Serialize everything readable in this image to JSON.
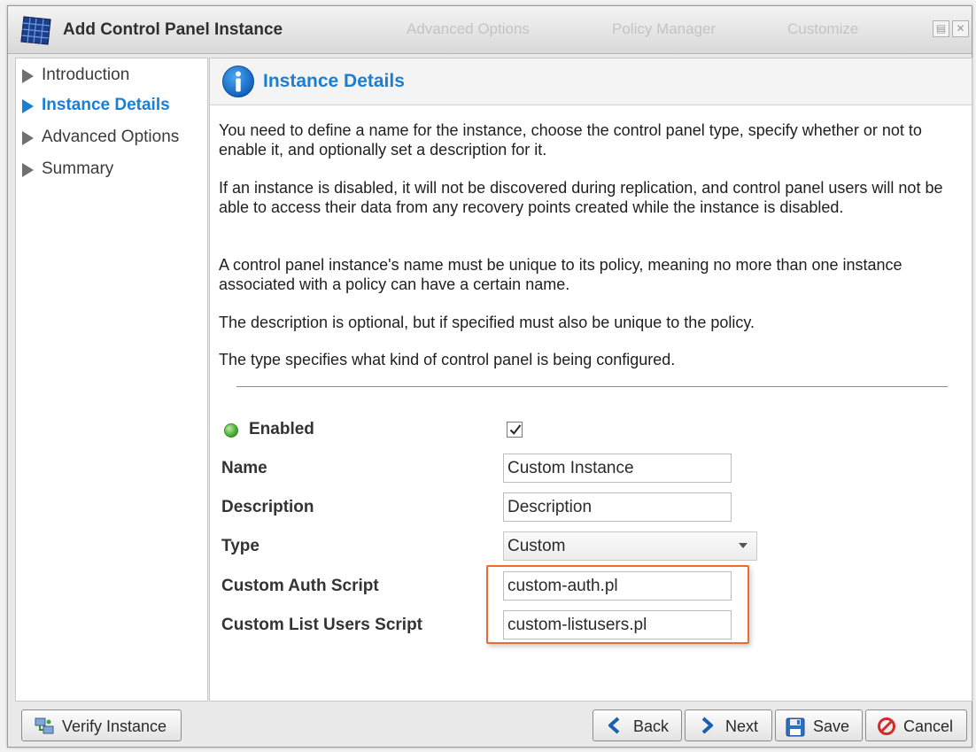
{
  "window": {
    "title": "Add Control Panel Instance",
    "ghost_items": [
      "Advanced Options",
      "Policy Manager",
      "Customize"
    ]
  },
  "nav": {
    "items": [
      {
        "label": "Introduction",
        "active": false
      },
      {
        "label": "Instance Details",
        "active": true
      },
      {
        "label": "Advanced Options",
        "active": false
      },
      {
        "label": "Summary",
        "active": false
      }
    ]
  },
  "main": {
    "title": "Instance Details",
    "paragraphs": [
      "You need to define a name for the instance, choose the control panel type, specify whether or not to enable it, and optionally set a description for it.",
      "If an instance is disabled, it will not be discovered during replication, and control panel users will not be able to access their data from any recovery points created while the instance is disabled.",
      "A control panel instance's name must be unique to its policy, meaning no more than one instance associated with a policy can have a certain name.",
      "The description is optional, but if specified must also be unique to the policy.",
      "The type specifies what kind of control panel is being configured."
    ]
  },
  "form": {
    "enabled_label": "Enabled",
    "enabled_checked": true,
    "name_label": "Name",
    "name_value": "Custom Instance",
    "description_label": "Description",
    "description_value": "Description",
    "type_label": "Type",
    "type_value": "Custom",
    "auth_label": "Custom Auth Script",
    "auth_value": "custom-auth.pl",
    "list_users_label": "Custom List Users Script",
    "list_users_value": "custom-listusers.pl"
  },
  "footer": {
    "verify_label": "Verify Instance",
    "back_label": "Back",
    "next_label": "Next",
    "save_label": "Save",
    "cancel_label": "Cancel"
  },
  "colors": {
    "accent": "#1a7fd3",
    "highlight": "#ef6a2e",
    "enabled_status": "#3aa028",
    "cancel": "#d22b2b"
  },
  "icons": {
    "title": "solar-panel-icon",
    "header": "info-icon",
    "verify": "network-icon",
    "back": "arrow-left-icon",
    "next": "arrow-right-icon",
    "save": "floppy-disk-icon",
    "cancel": "no-entry-icon"
  }
}
